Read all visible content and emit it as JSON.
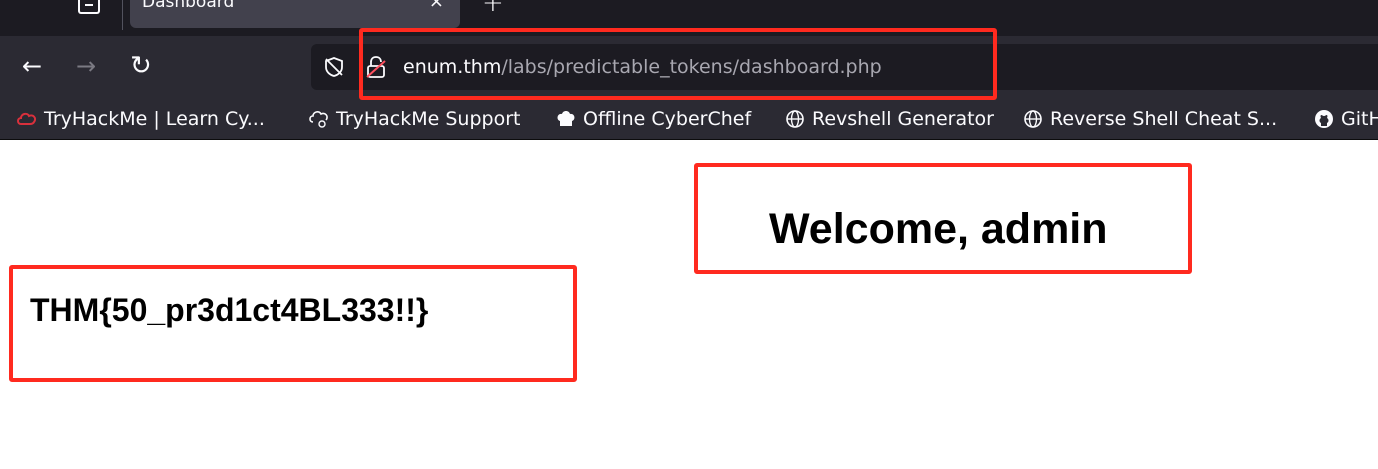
{
  "browser": {
    "tab": {
      "title": "Dashboard",
      "close_glyph": "×"
    },
    "new_tab_glyph": "+",
    "nav": {
      "back_glyph": "←",
      "forward_glyph": "→",
      "reload_glyph": "↻"
    },
    "url": {
      "host": "enum.thm",
      "path": "/labs/predictable_tokens/dashboard.php"
    },
    "bookmarks": [
      {
        "label": "TryHackMe | Learn Cy...",
        "icon": "tryhackme-cloud-icon"
      },
      {
        "label": "TryHackMe Support",
        "icon": "tryhackme-support-icon"
      },
      {
        "label": "Offline CyberChef",
        "icon": "chef-hat-icon"
      },
      {
        "label": "Revshell Generator",
        "icon": "globe-icon"
      },
      {
        "label": "Reverse Shell Cheat S...",
        "icon": "globe-icon"
      },
      {
        "label": "GitH",
        "icon": "github-icon"
      }
    ]
  },
  "page": {
    "welcome": "Welcome, admin",
    "flag": "THM{50_pr3d1ct4BL333!!}"
  },
  "colors": {
    "annotation": "#ff2a1f",
    "toolbar": "#2b2a33",
    "tabstrip": "#1c1b22"
  }
}
